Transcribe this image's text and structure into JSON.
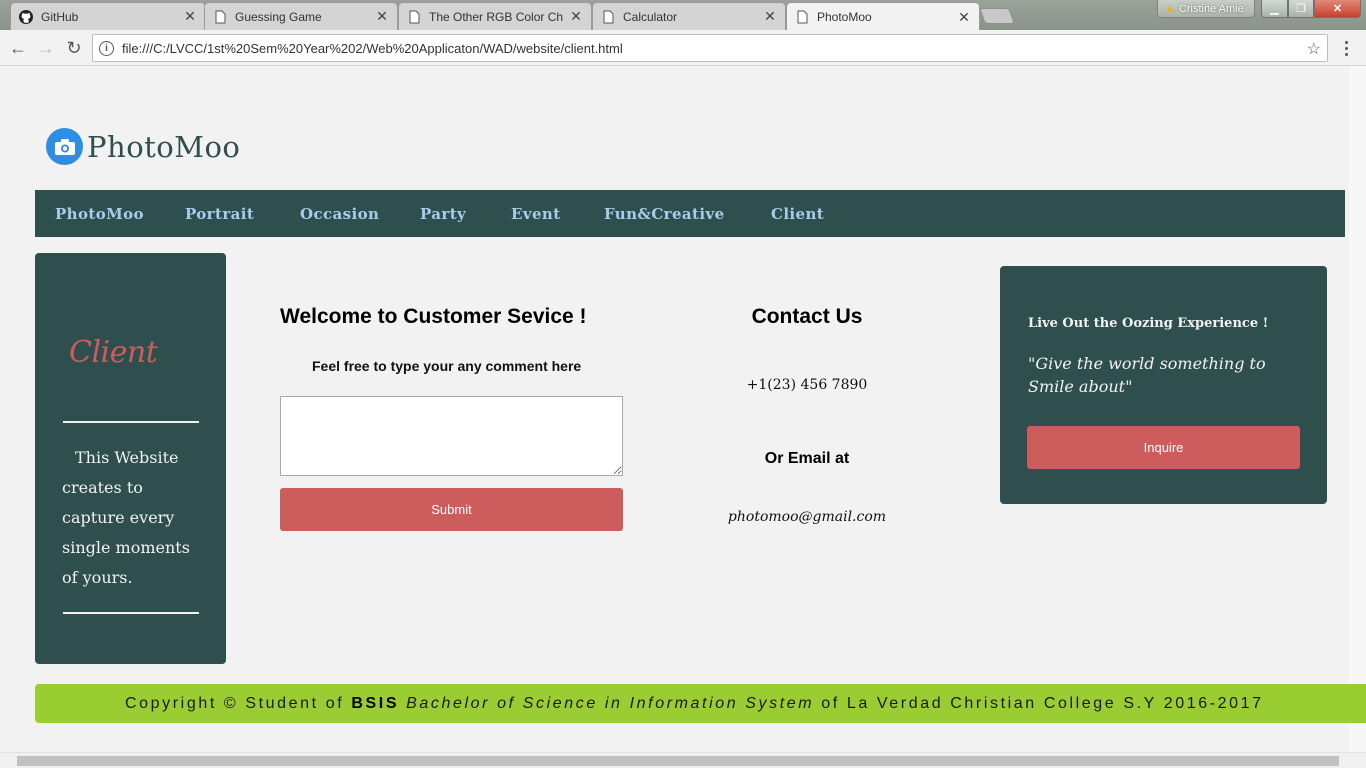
{
  "browser": {
    "tabs": [
      {
        "title": "GitHub",
        "icon": "github-icon"
      },
      {
        "title": "Guessing Game",
        "icon": "page-icon"
      },
      {
        "title": "The Other RGB Color Ch",
        "icon": "page-icon"
      },
      {
        "title": "Calculator",
        "icon": "page-icon"
      },
      {
        "title": "PhotoMoo",
        "icon": "page-icon",
        "active": true
      }
    ],
    "user_name": "Cristine Amie",
    "url": "file:///C:/LVCC/1st%20Sem%20Year%202/Web%20Applicaton/WAD/website/client.html"
  },
  "site": {
    "logo_text": "PhotoMoo",
    "nav": [
      "PhotoMoo",
      "Portrait",
      "Occasion",
      "Party",
      "Event",
      "Fun&Creative",
      "Client"
    ]
  },
  "left_panel": {
    "title": "Client",
    "text": "This Website creates to capture every single moments of yours."
  },
  "center": {
    "heading": "Welcome to Customer Sevice !",
    "subheading": "Feel free to type your any comment here",
    "comment_value": "",
    "submit_label": "Submit"
  },
  "contact": {
    "heading": "Contact Us",
    "phone": "+1(23) 456 7890",
    "email_heading": "Or Email at",
    "email": "photomoo@gmail.com"
  },
  "right_panel": {
    "heading": "Live Out the Oozing Experience !",
    "quote": "\"Give the world something to Smile about\"",
    "button_label": "Inquire"
  },
  "footer": {
    "prefix": "Copyright © Student of",
    "abbr": "BSIS",
    "program": "Bachelor of Science in Information System",
    "suffix": "of La Verdad Christian College S.Y 2016-2017"
  },
  "colors": {
    "panel": "#2f4f4f",
    "accent": "#cd5c5c",
    "nav_link": "#a8cdec",
    "footer": "#9acd32"
  }
}
